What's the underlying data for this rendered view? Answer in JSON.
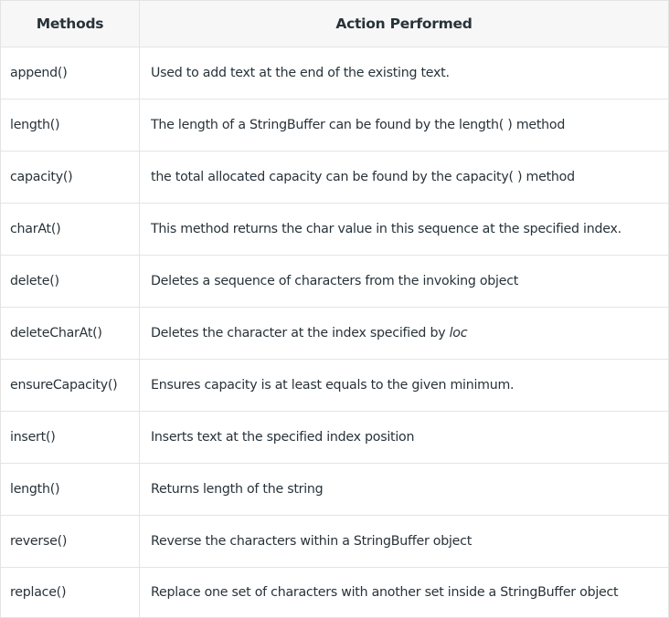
{
  "table": {
    "headers": [
      "Methods",
      "Action Performed"
    ],
    "rows": [
      {
        "method": "append()",
        "action": "Used to add text at the end of the existing text."
      },
      {
        "method": "length()",
        "action": "The length of a StringBuffer can be found by the length( ) method"
      },
      {
        "method": "capacity()",
        "action": "the total allocated capacity can be found by the capacity( ) method"
      },
      {
        "method": "charAt()",
        "action": "This method returns the char value in this sequence at the specified index."
      },
      {
        "method": "delete()",
        "action": "Deletes a sequence of characters from the invoking object"
      },
      {
        "method": "deleteCharAt()",
        "action": "Deletes the character at the index specified by ",
        "action_italic": "loc"
      },
      {
        "method": "ensureCapacity()",
        "action": "Ensures capacity is at least equals to the given minimum."
      },
      {
        "method": "insert()",
        "action": "Inserts text at the specified index position"
      },
      {
        "method": "length()",
        "action": "Returns length of the string"
      },
      {
        "method": "reverse()",
        "action": "Reverse the characters within a StringBuffer object"
      },
      {
        "method": "replace()",
        "action": "Replace one set of characters with another set inside a StringBuffer object"
      }
    ]
  }
}
